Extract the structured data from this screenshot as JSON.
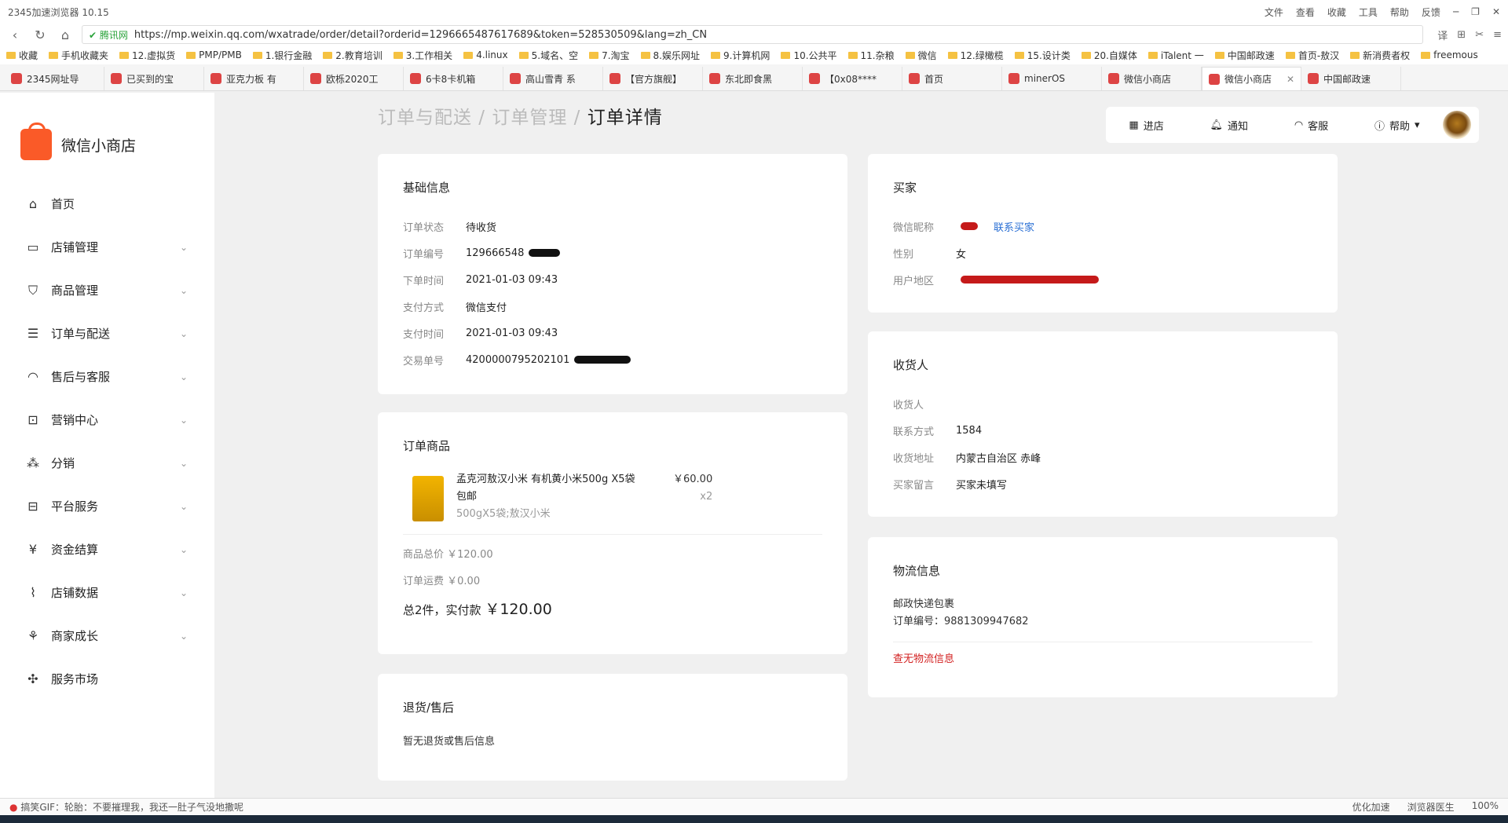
{
  "browser": {
    "title": "2345加速浏览器 10.15",
    "menu": [
      "文件",
      "查看",
      "收藏",
      "工具",
      "帮助",
      "反馈"
    ],
    "secure_label": "腾讯网",
    "url": "https://mp.weixin.qq.com/wxatrade/order/detail?orderid=1296665487617689&token=528530509&lang=zh_CN",
    "bookmarks": [
      "收藏",
      "手机收藏夹",
      "12.虚拟货",
      "PMP/PMB",
      "1.银行金融",
      "2.教育培训",
      "3.工作相关",
      "4.linux",
      "5.域名、空",
      "7.淘宝",
      "8.娱乐网址",
      "9.计算机网",
      "10.公共平",
      "11.杂粮",
      "微信",
      "12.绿橄榄",
      "15.设计类",
      "20.自媒体",
      "iTalent 一",
      "中国邮政速",
      "首页-敖汉",
      "新消费者权",
      "freemous"
    ],
    "tabs": [
      "2345网址导",
      "已买到的宝",
      "亚克力板 有",
      "欧栎2020工",
      "6卡8卡机箱",
      "高山雪青 系",
      "【官方旗舰】",
      "东北即食黑",
      "【0x08****",
      "首页",
      "minerOS",
      "微信小商店",
      "微信小商店",
      "中国邮政速"
    ],
    "status_text": "搞笑GIF：轮胎：不要摧理我，我还一肚子气没地撒呢",
    "status_right": [
      "优化加速",
      "浏览器医生",
      "100%"
    ]
  },
  "sidebar": {
    "app_name": "微信小商店",
    "items": [
      {
        "label": "首页",
        "icon": "home-icon",
        "glyph": "⌂"
      },
      {
        "label": "店铺管理",
        "icon": "store-icon",
        "glyph": "▭"
      },
      {
        "label": "商品管理",
        "icon": "bag-icon",
        "glyph": "⛉"
      },
      {
        "label": "订单与配送",
        "icon": "order-icon",
        "glyph": "☰"
      },
      {
        "label": "售后与客服",
        "icon": "headset-icon",
        "glyph": "◠"
      },
      {
        "label": "营销中心",
        "icon": "ticket-icon",
        "glyph": "⊡"
      },
      {
        "label": "分销",
        "icon": "share-icon",
        "glyph": "⁂"
      },
      {
        "label": "平台服务",
        "icon": "briefcase-icon",
        "glyph": "⊟"
      },
      {
        "label": "资金结算",
        "icon": "yuan-icon",
        "glyph": "¥"
      },
      {
        "label": "店铺数据",
        "icon": "chart-icon",
        "glyph": "⌇"
      },
      {
        "label": "商家成长",
        "icon": "sprout-icon",
        "glyph": "⚘"
      },
      {
        "label": "服务市场",
        "icon": "puzzle-icon",
        "glyph": "✣"
      }
    ]
  },
  "breadcrumb": {
    "l1": "订单与配送",
    "l2": "订单管理",
    "current": "订单详情",
    "sep": " / "
  },
  "topbar": {
    "enter_shop": "进店",
    "notify": "通知",
    "service": "客服",
    "help": "帮助"
  },
  "basic": {
    "title": "基础信息",
    "rows": [
      {
        "k": "订单状态",
        "v": "待收货"
      },
      {
        "k": "订单编号",
        "v": "129666548"
      },
      {
        "k": "下单时间",
        "v": "2021-01-03 09:43"
      },
      {
        "k": "支付方式",
        "v": "微信支付"
      },
      {
        "k": "支付时间",
        "v": "2021-01-03 09:43"
      },
      {
        "k": "交易单号",
        "v": "4200000795202101"
      }
    ]
  },
  "goods": {
    "title": "订单商品",
    "name": "孟克河敖汉小米 有机黄小米500g X5袋 包邮",
    "spec": "500gX5袋;敖汉小米",
    "price": "￥60.00",
    "qty": "x2",
    "subtotal_label": "商品总价",
    "subtotal": "￥120.00",
    "freight_label": "订单运费",
    "freight": "￥0.00",
    "total_prefix": "总2件，实付款",
    "total": "￥120.00"
  },
  "aftersale": {
    "title": "退货/售后",
    "text": "暂无退货或售后信息"
  },
  "buyer": {
    "title": "买家",
    "nick_label": "微信昵称",
    "contact_link": "联系买家",
    "gender_label": "性别",
    "gender": "女",
    "region_label": "用户地区"
  },
  "receiver": {
    "title": "收货人",
    "rows": [
      {
        "k": "收货人",
        "v": ""
      },
      {
        "k": "联系方式",
        "v": "1584"
      },
      {
        "k": "收货地址",
        "v": "内蒙古自治区 赤峰"
      },
      {
        "k": "买家留言",
        "v": "买家未填写"
      }
    ]
  },
  "logistics": {
    "title": "物流信息",
    "carrier": "邮政快递包裹",
    "tracking_label": "订单编号：",
    "tracking": "9881309947682",
    "query_link": "查无物流信息"
  }
}
